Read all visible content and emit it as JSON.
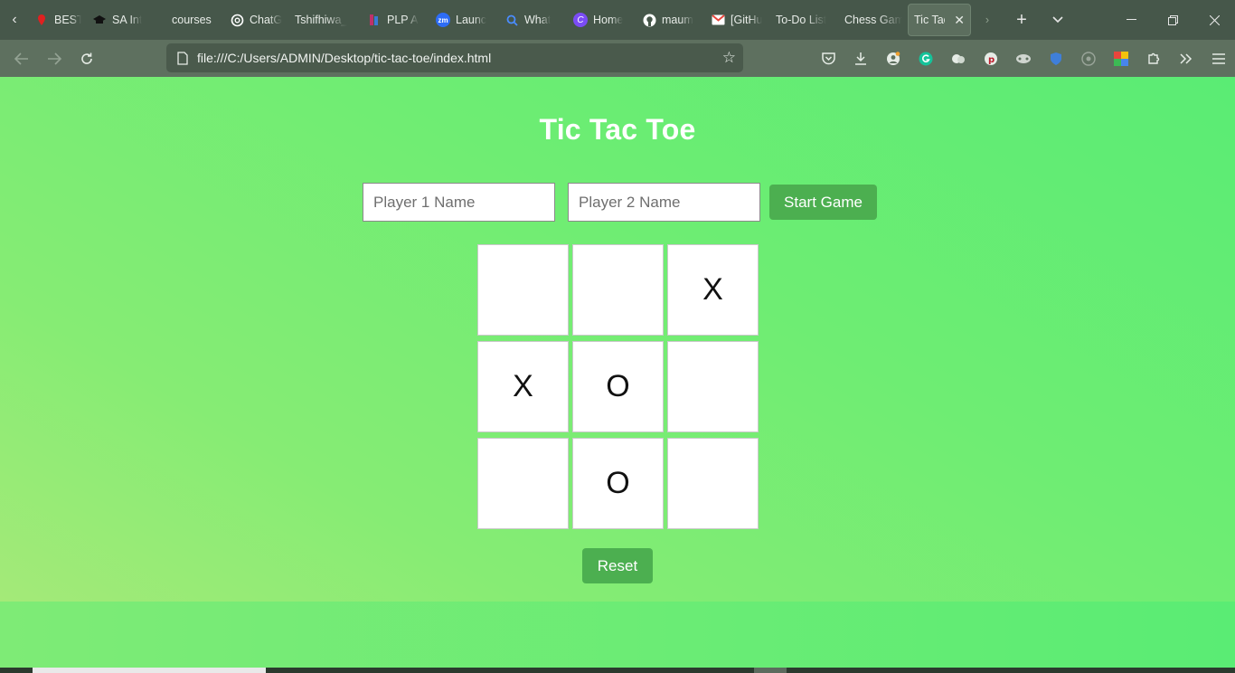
{
  "browser": {
    "tabs": [
      {
        "title": "BEST I",
        "icon": "red-pin-icon",
        "color": "#e02020"
      },
      {
        "title": "SA Int",
        "icon": "graduation-cap-icon",
        "color": "#111111"
      },
      {
        "title": "courses",
        "icon": "",
        "color": ""
      },
      {
        "title": "ChatG",
        "icon": "chatgpt-icon",
        "color": "#ffffff"
      },
      {
        "title": "Tshifhiwa_",
        "icon": "",
        "color": ""
      },
      {
        "title": "PLP A",
        "icon": "plp-icon",
        "color": "#c0306a"
      },
      {
        "title": "Launc",
        "icon": "zoom-icon",
        "color": "#2d6cf5"
      },
      {
        "title": "What",
        "icon": "search-icon",
        "color": "#4a8cff"
      },
      {
        "title": "Home",
        "icon": "canva-icon",
        "color": "#7b4cf5"
      },
      {
        "title": "maum",
        "icon": "github-icon",
        "color": "#ffffff"
      },
      {
        "title": "[GitHu",
        "icon": "gmail-icon",
        "color": "#e8453c"
      },
      {
        "title": "To-Do List",
        "icon": "",
        "color": ""
      },
      {
        "title": "Chess Gam",
        "icon": "",
        "color": ""
      }
    ],
    "active_tab": {
      "title": "Tic Tac"
    },
    "url": "file:///C:/Users/ADMIN/Desktop/tic-tac-toe/index.html"
  },
  "game": {
    "title": "Tic Tac Toe",
    "player1_placeholder": "Player 1 Name",
    "player2_placeholder": "Player 2 Name",
    "start_label": "Start Game",
    "reset_label": "Reset",
    "board": [
      "",
      "",
      "X",
      "X",
      "O",
      "",
      "",
      "O",
      ""
    ]
  },
  "colors": {
    "button": "#4caf50",
    "page_green": "#6ded73"
  }
}
